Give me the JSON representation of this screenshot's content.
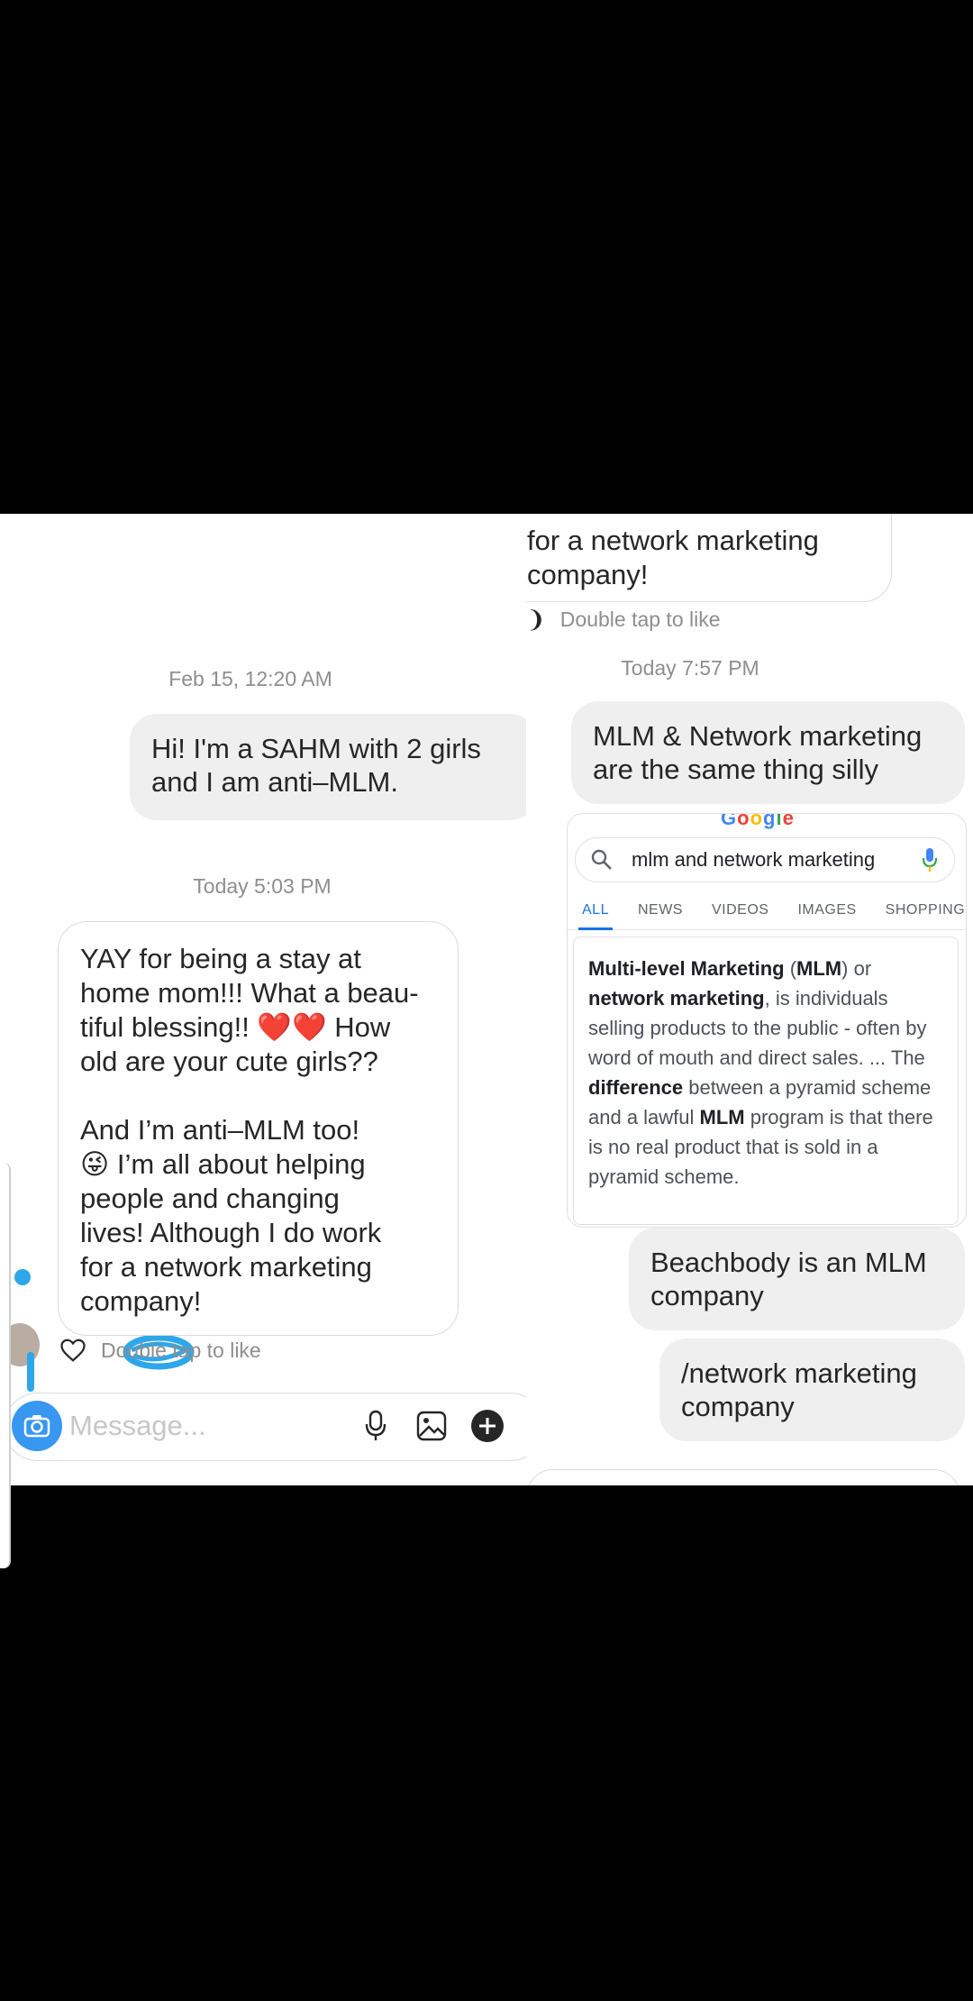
{
  "left": {
    "top_timestamp": "Feb 15, 12:20 AM",
    "incoming_message": "Hi! I'm a SAHM with 2 girls\nand I am anti–MLM.",
    "mid_timestamp": "Today 5:03 PM",
    "reply_message": "YAY for being a stay at\nhome mom!!! What a beau-\ntiful blessing!! ❤️❤️ How\nold are your cute girls??\n\nAnd I’m anti–MLM too!\n😜 I’m all about helping\npeople and changing\nlives! Although I do work\nfor a network marketing\ncompany!",
    "like_hint": "Double tap to like",
    "composer_placeholder": "Message...",
    "icons": [
      "camera-icon",
      "microphone-icon",
      "gallery-icon",
      "add-icon",
      "heart-icon"
    ]
  },
  "right": {
    "prev_message_tail": "for a network marketing\ncompany!",
    "like_hint": "Double tap to like",
    "timestamp": "Today 7:57 PM",
    "msg1": "MLM & Network marketing\nare the same thing silly",
    "google": {
      "query": "mlm and network marketing",
      "tabs": [
        "ALL",
        "NEWS",
        "VIDEOS",
        "IMAGES",
        "SHOPPING"
      ],
      "snippet_parts": [
        {
          "b": true,
          "t": "Multi-level Marketing"
        },
        {
          "b": false,
          "t": " ("
        },
        {
          "b": true,
          "t": "MLM"
        },
        {
          "b": false,
          "t": ") or "
        },
        {
          "b": true,
          "t": "network marketing"
        },
        {
          "b": false,
          "t": ", is individuals selling products to the public - often by word of mouth and direct sales. ... The "
        },
        {
          "b": true,
          "t": "difference"
        },
        {
          "b": false,
          "t": " between a pyramid scheme and a lawful "
        },
        {
          "b": true,
          "t": "MLM"
        },
        {
          "b": false,
          "t": " program is that there is no real product that is sold in a pyramid scheme."
        }
      ]
    },
    "msg2": "Beachbody is an MLM\ncompany",
    "msg3": "/network marketing\ncompany"
  }
}
